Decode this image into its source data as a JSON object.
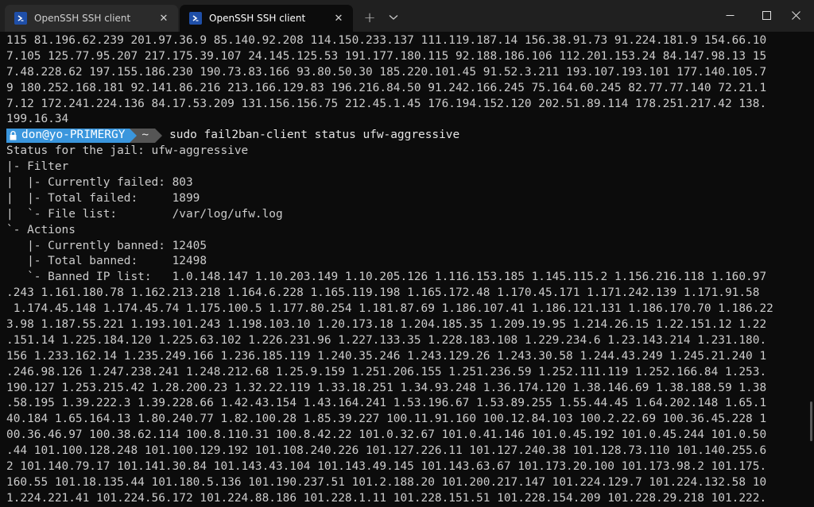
{
  "tabs": [
    {
      "title": "OpenSSH SSH client",
      "active": false
    },
    {
      "title": "OpenSSH SSH client",
      "active": true
    }
  ],
  "window_controls": {
    "new_tab": "+",
    "minimize": "minimize",
    "maximize": "maximize",
    "close": "close"
  },
  "colors": {
    "prompt_user_bg": "#3a96dd",
    "prompt_dir_bg": "#555555",
    "terminal_bg": "#0c0c0c",
    "terminal_fg": "#cccccc"
  },
  "terminal": {
    "lines_before": [
      "115 81.196.62.239 201.97.36.9 85.140.92.208 114.150.233.137 111.119.187.14 156.38.91.73 91.224.181.9 154.66.10",
      "7.105 125.77.95.207 217.175.39.107 24.145.125.53 191.177.180.115 92.188.186.106 112.201.153.24 84.147.98.13 15",
      "7.48.228.62 197.155.186.230 190.73.83.166 93.80.50.30 185.220.101.45 91.52.3.211 193.107.193.101 177.140.105.7",
      "9 180.252.168.181 92.141.86.216 213.166.129.83 196.216.84.50 91.242.166.245 75.164.60.245 82.77.77.140 72.21.1",
      "7.12 172.241.224.136 84.17.53.209 131.156.156.75 212.45.1.45 176.194.152.120 202.51.89.114 178.251.217.42 138.",
      "199.16.34"
    ],
    "prompt": {
      "user": "don@yo-PRIMERGY",
      "dir": "~",
      "command": "sudo fail2ban-client status ufw-aggressive"
    },
    "lines_after": [
      "Status for the jail: ufw-aggressive",
      "|- Filter",
      "|  |- Currently failed: 803",
      "|  |- Total failed:     1899",
      "|  `- File list:        /var/log/ufw.log",
      "`- Actions",
      "   |- Currently banned: 12405",
      "   |- Total banned:     12498",
      "   `- Banned IP list:   1.0.148.147 1.10.203.149 1.10.205.126 1.116.153.185 1.145.115.2 1.156.216.118 1.160.97",
      ".243 1.161.180.78 1.162.213.218 1.164.6.228 1.165.119.198 1.165.172.48 1.170.45.171 1.171.242.139 1.171.91.58",
      " 1.174.45.148 1.174.45.74 1.175.100.5 1.177.80.254 1.181.87.69 1.186.107.41 1.186.121.131 1.186.170.70 1.186.22",
      "3.98 1.187.55.221 1.193.101.243 1.198.103.10 1.20.173.18 1.204.185.35 1.209.19.95 1.214.26.15 1.22.151.12 1.22",
      ".151.14 1.225.184.120 1.225.63.102 1.226.231.96 1.227.133.35 1.228.183.108 1.229.234.6 1.23.143.214 1.231.180.",
      "156 1.233.162.14 1.235.249.166 1.236.185.119 1.240.35.246 1.243.129.26 1.243.30.58 1.244.43.249 1.245.21.240 1",
      ".246.98.126 1.247.238.241 1.248.212.68 1.25.9.159 1.251.206.155 1.251.236.59 1.252.111.119 1.252.166.84 1.253.",
      "190.127 1.253.215.42 1.28.200.23 1.32.22.119 1.33.18.251 1.34.93.248 1.36.174.120 1.38.146.69 1.38.188.59 1.38",
      ".58.195 1.39.222.3 1.39.228.66 1.42.43.154 1.43.164.241 1.53.196.67 1.53.89.255 1.55.44.45 1.64.202.148 1.65.1",
      "40.184 1.65.164.13 1.80.240.77 1.82.100.28 1.85.39.227 100.11.91.160 100.12.84.103 100.2.22.69 100.36.45.228 1",
      "00.36.46.97 100.38.62.114 100.8.110.31 100.8.42.22 101.0.32.67 101.0.41.146 101.0.45.192 101.0.45.244 101.0.50",
      ".44 101.100.128.248 101.100.129.192 101.108.240.226 101.127.226.11 101.127.240.38 101.128.73.110 101.140.255.6",
      "2 101.140.79.17 101.141.30.84 101.143.43.104 101.143.49.145 101.143.63.67 101.173.20.100 101.173.98.2 101.175.",
      "160.55 101.18.135.44 101.180.5.136 101.190.237.51 101.2.188.20 101.200.217.147 101.224.129.7 101.224.132.58 10",
      "1.224.221.41 101.224.56.172 101.224.88.186 101.228.1.11 101.228.151.51 101.228.154.209 101.228.29.218 101.222."
    ]
  }
}
